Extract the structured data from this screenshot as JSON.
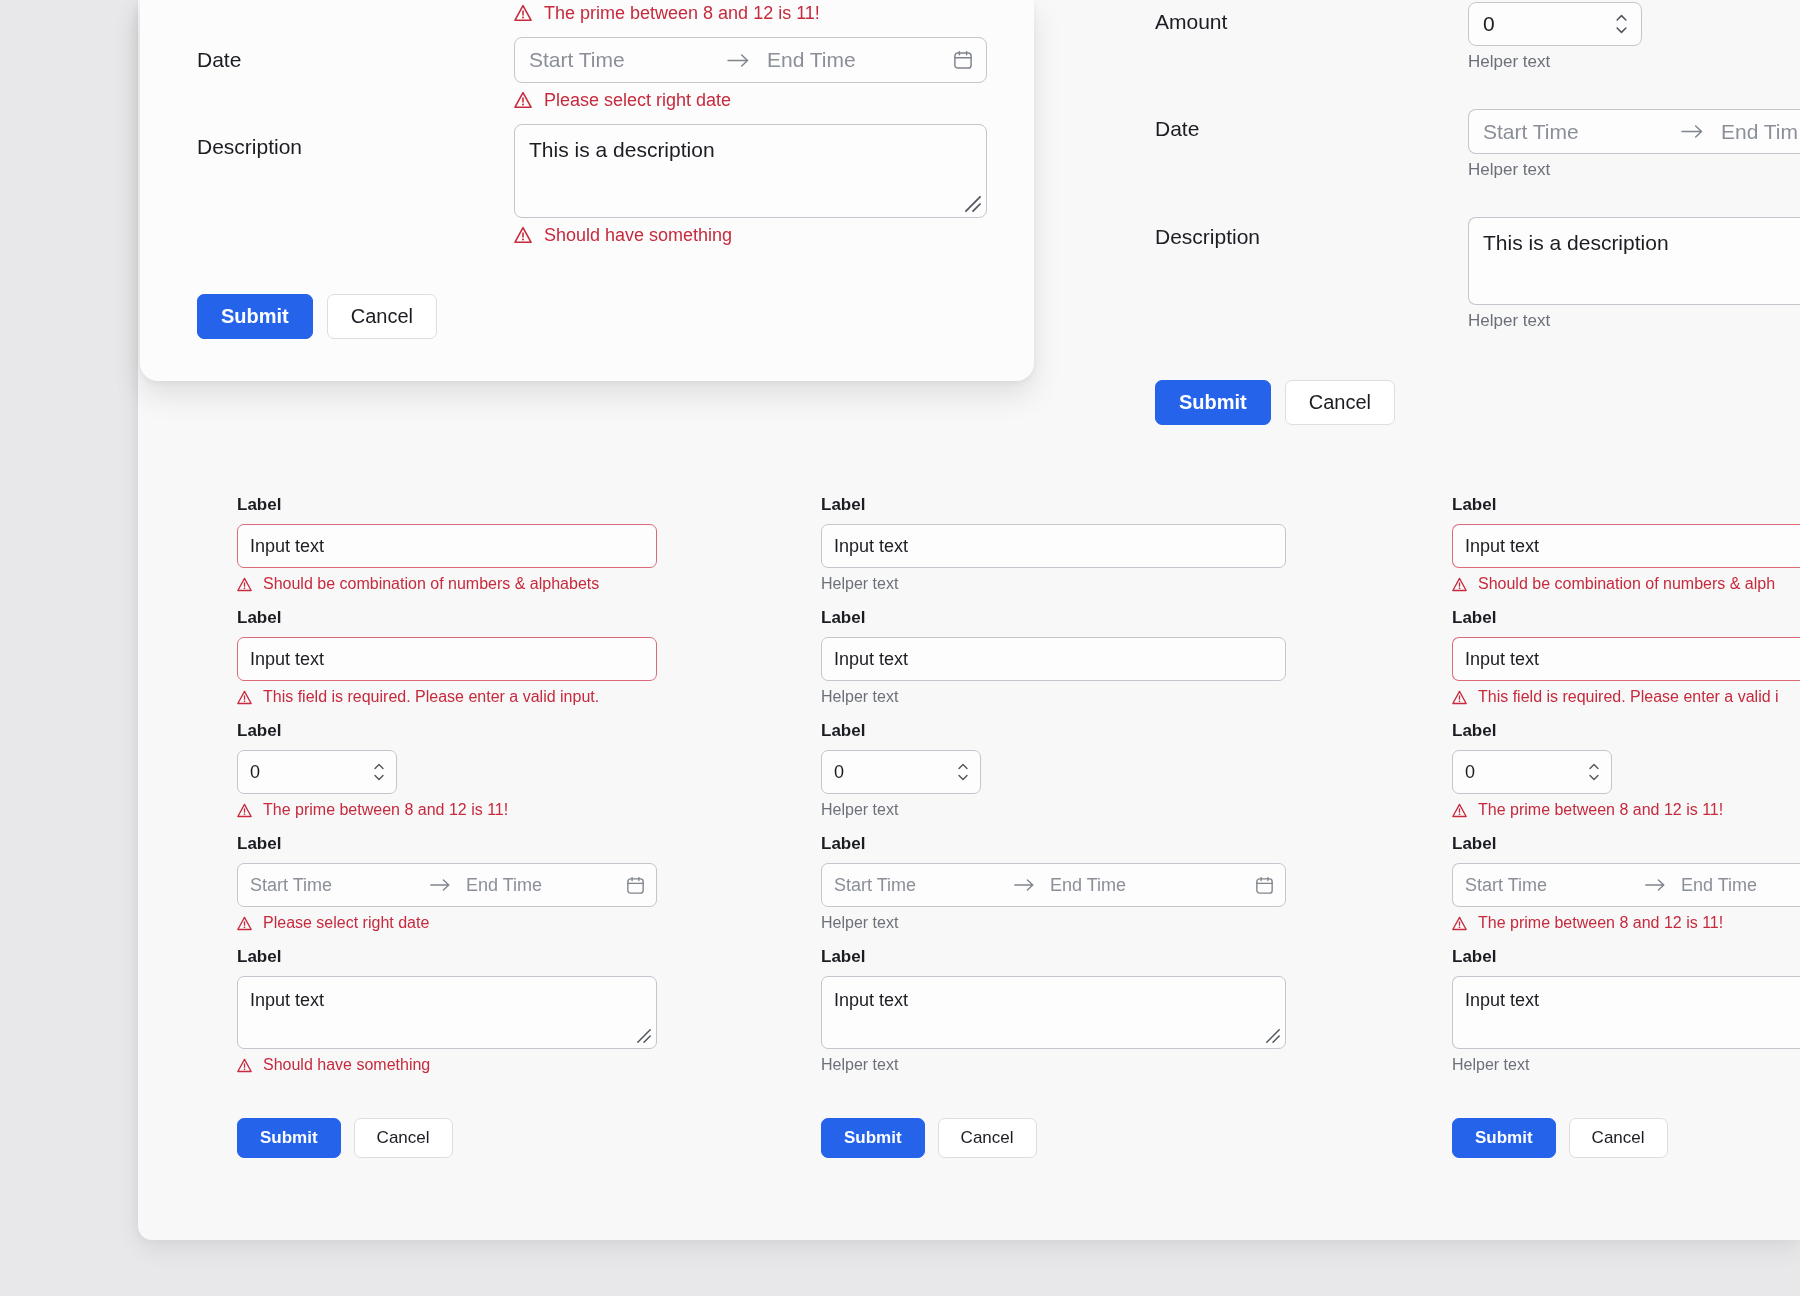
{
  "modal_form": {
    "rows": [
      {
        "kind": "message_only",
        "message": {
          "kind": "error",
          "text": "The prime between 8 and 12 is 11!"
        }
      },
      {
        "kind": "date_range",
        "label": "Date",
        "start": {
          "placeholder": "Start Time"
        },
        "end": {
          "placeholder": "End Time"
        },
        "invalid": false,
        "clipped": false,
        "message": {
          "kind": "error",
          "text": "Please select right date"
        }
      },
      {
        "kind": "textarea",
        "label": "Description",
        "value": "This is a description",
        "invalid": false,
        "clipped": false,
        "message": {
          "kind": "error",
          "text": "Should have something"
        }
      }
    ],
    "buttons": [
      {
        "kind": "submit",
        "label": "Submit"
      },
      {
        "kind": "cancel",
        "label": "Cancel"
      }
    ]
  },
  "side_form": {
    "rows": [
      {
        "kind": "number",
        "label": "Amount",
        "value": "0",
        "invalid": false,
        "clipped": false,
        "message": {
          "kind": "helper",
          "text": "Helper text"
        }
      },
      {
        "kind": "date_range",
        "label": "Date",
        "start": {
          "placeholder": "Start Time"
        },
        "end": {
          "placeholder": "End Tim"
        },
        "invalid": false,
        "clipped": true,
        "message": {
          "kind": "helper",
          "text": "Helper text"
        }
      },
      {
        "kind": "textarea",
        "label": "Description",
        "value": "This is a description",
        "invalid": false,
        "clipped": true,
        "message": {
          "kind": "helper",
          "text": "Helper text"
        }
      }
    ],
    "buttons": [
      {
        "kind": "submit",
        "label": "Submit"
      },
      {
        "kind": "cancel",
        "label": "Cancel"
      }
    ]
  },
  "form_columns": [
    {
      "fields": [
        {
          "kind": "text",
          "label": "Label",
          "value": "Input text",
          "invalid": true,
          "clipped": false,
          "message": {
            "kind": "error",
            "text": "Should be combination of numbers & alphabets"
          }
        },
        {
          "kind": "text",
          "label": "Label",
          "value": "Input text",
          "invalid": true,
          "clipped": false,
          "message": {
            "kind": "error",
            "text": "This field is required. Please enter a valid input."
          }
        },
        {
          "kind": "number",
          "label": "Label",
          "value": "0",
          "invalid": false,
          "clipped": false,
          "message": {
            "kind": "error",
            "text": "The prime between 8 and 12 is 11!"
          }
        },
        {
          "kind": "date_range",
          "label": "Label",
          "start": {
            "placeholder": "Start Time"
          },
          "end": {
            "placeholder": "End Time"
          },
          "invalid": false,
          "clipped": false,
          "message": {
            "kind": "error",
            "text": "Please select right date"
          }
        },
        {
          "kind": "textarea",
          "label": "Label",
          "value": "Input text",
          "invalid": false,
          "clipped": false,
          "message": {
            "kind": "error",
            "text": "Should have something"
          }
        }
      ],
      "buttons": [
        {
          "kind": "submit",
          "label": "Submit"
        },
        {
          "kind": "cancel",
          "label": "Cancel"
        }
      ]
    },
    {
      "fields": [
        {
          "kind": "text",
          "label": "Label",
          "value": "Input text",
          "invalid": false,
          "clipped": false,
          "message": {
            "kind": "helper",
            "text": "Helper text"
          }
        },
        {
          "kind": "text",
          "label": "Label",
          "value": "Input text",
          "invalid": false,
          "clipped": false,
          "message": {
            "kind": "helper",
            "text": "Helper text"
          }
        },
        {
          "kind": "number",
          "label": "Label",
          "value": "0",
          "invalid": false,
          "clipped": false,
          "message": {
            "kind": "helper",
            "text": "Helper text"
          }
        },
        {
          "kind": "date_range",
          "label": "Label",
          "start": {
            "placeholder": "Start Time"
          },
          "end": {
            "placeholder": "End Time"
          },
          "invalid": false,
          "clipped": false,
          "message": {
            "kind": "helper",
            "text": "Helper text"
          }
        },
        {
          "kind": "textarea",
          "label": "Label",
          "value": "Input text",
          "invalid": false,
          "clipped": false,
          "message": {
            "kind": "helper",
            "text": "Helper text"
          }
        }
      ],
      "buttons": [
        {
          "kind": "submit",
          "label": "Submit"
        },
        {
          "kind": "cancel",
          "label": "Cancel"
        }
      ]
    },
    {
      "fields": [
        {
          "kind": "text",
          "label": "Label",
          "value": "Input text",
          "invalid": true,
          "clipped": true,
          "message": {
            "kind": "error",
            "text": "Should be combination of numbers & alph"
          }
        },
        {
          "kind": "text",
          "label": "Label",
          "value": "Input text",
          "invalid": true,
          "clipped": true,
          "message": {
            "kind": "error",
            "text": "This field is required. Please enter a valid i"
          }
        },
        {
          "kind": "number",
          "label": "Label",
          "value": "0",
          "invalid": false,
          "clipped": false,
          "message": {
            "kind": "error",
            "text": "The prime between 8 and 12 is 11!"
          }
        },
        {
          "kind": "date_range",
          "label": "Label",
          "start": {
            "placeholder": "Start Time"
          },
          "end": {
            "placeholder": "End Time"
          },
          "invalid": false,
          "clipped": true,
          "message": {
            "kind": "error",
            "text": "The prime between 8 and 12 is 11!"
          }
        },
        {
          "kind": "textarea",
          "label": "Label",
          "value": "Input text",
          "invalid": false,
          "clipped": true,
          "message": {
            "kind": "helper",
            "text": "Helper text"
          }
        }
      ],
      "buttons": [
        {
          "kind": "submit",
          "label": "Submit"
        },
        {
          "kind": "cancel",
          "label": "Cancel"
        }
      ]
    }
  ]
}
